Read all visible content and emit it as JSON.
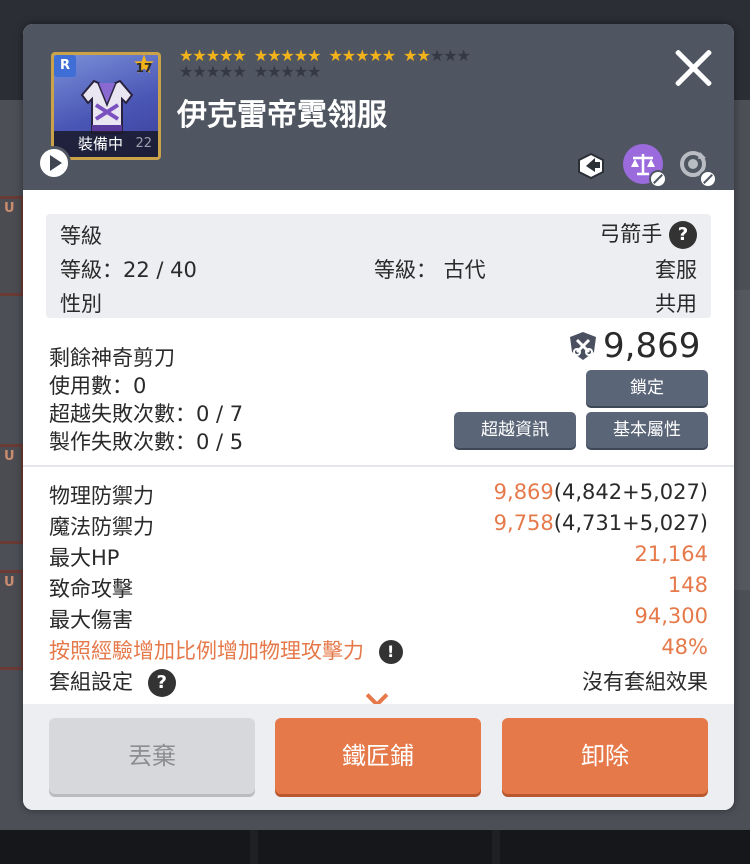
{
  "item": {
    "name": "伊克雷帝霓翎服",
    "rarity": "R",
    "star_level": "17",
    "equipped_label": "裝備中",
    "level_short": "22",
    "stars_row1": [
      "★★★★★",
      "★★★★★",
      "★★★★★",
      "★★"
    ],
    "stars_row1_off": "★★★",
    "stars_row2_off": [
      "★★★★★",
      "★★★★★"
    ],
    "stars_filled": 17,
    "stars_total": 30
  },
  "header_icons": [
    "share-icon",
    "balance-scale-icon",
    "reset-icon"
  ],
  "info": {
    "rank_label": "等級",
    "class_label": "弓箭手",
    "level_text": "等級：22 / 40",
    "grade_text": "等級： 古代",
    "set_type": "套服",
    "gender_label": "性別",
    "gender_value": "共用"
  },
  "scissors": {
    "label": "剩餘神奇剪刀",
    "value": "9,869",
    "use_count": "使用數：0",
    "transcend_fail": "超越失敗次數：0 / 7",
    "craft_fail": "製作失敗次數：0 / 5"
  },
  "buttons": {
    "lock": "鎖定",
    "transcend_info": "超越資訊",
    "base_attr": "基本屬性",
    "discard": "丟棄",
    "blacksmith": "鐵匠鋪",
    "unequip": "卸除"
  },
  "stats": [
    {
      "label": "物理防禦力",
      "value_main": "9,869",
      "value_extra": "(4,842+5,027)"
    },
    {
      "label": "魔法防禦力",
      "value_main": "9,758",
      "value_extra": "(4,731+5,027)"
    },
    {
      "label": "最大HP",
      "value_main": "21,164",
      "value_extra": ""
    },
    {
      "label": "致命攻擊",
      "value_main": "148",
      "value_extra": ""
    },
    {
      "label": "最大傷害",
      "value_main": "94,300",
      "value_extra": ""
    },
    {
      "label": "按照經驗增加比例增加物理攻擊力",
      "value_main": "48%",
      "value_extra": ""
    }
  ],
  "set_setting": {
    "label": "套組設定",
    "value": "沒有套組效果"
  },
  "colors": {
    "header_bg": "#4f5661",
    "accent_orange": "#e6794a",
    "button_slate": "#5a6577",
    "star_gold": "#f2b21c"
  }
}
